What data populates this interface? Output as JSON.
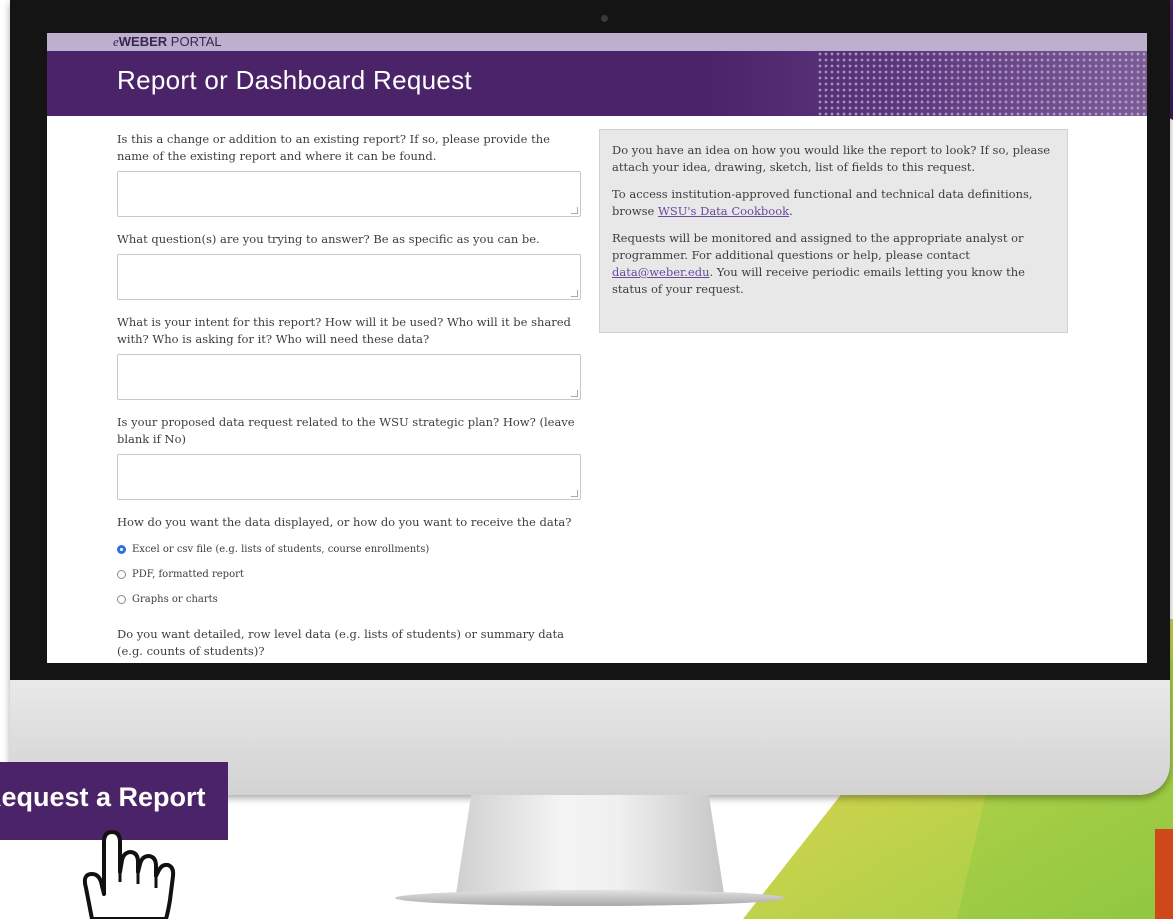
{
  "portal": {
    "brand_e": "e",
    "brand_weber": "WEBER",
    "brand_portal": " PORTAL",
    "page_title": "Report or Dashboard Request"
  },
  "form": {
    "questions": [
      {
        "label": "Is this a change or addition to an existing report? If so, please provide the name of the existing report and where it can be found."
      },
      {
        "label": "What question(s) are you trying to answer? Be as specific as you can be."
      },
      {
        "label": "What is your intent for this report? How will it be used? Who will it be shared with? Who is asking for it? Who will need these data?"
      },
      {
        "label": "Is your proposed data request related to the WSU strategic plan? How? (leave blank if No)"
      }
    ],
    "display_question": "How do you want the data displayed, or how do you want to receive the data?",
    "display_options": [
      {
        "label": "Excel or csv file (e.g. lists of students, course enrollments)",
        "selected": true
      },
      {
        "label": "PDF, formatted report",
        "selected": false
      },
      {
        "label": "Graphs or charts",
        "selected": false
      }
    ],
    "detail_question": "Do you want detailed, row level data (e.g. lists of students) or summary data (e.g. counts of students)?"
  },
  "info": {
    "p1": "Do you have an idea on how you would like the report to look? If so, please attach your idea, drawing, sketch, list of fields to this request.",
    "p2_before": "To access institution-approved functional and technical data definitions, browse ",
    "p2_link": "WSU's Data Cookbook",
    "p2_after": ".",
    "p3_before": "Requests will be monitored and assigned to the appropriate analyst or programmer. For additional questions or help, please contact ",
    "p3_link": "data@weber.edu",
    "p3_after": ". You will receive periodic emails letting you know the status of your request."
  },
  "request_button": {
    "label": "Request a Report"
  },
  "colors": {
    "brand_purple": "#4b2369",
    "radio_selected": "#2f6fe0",
    "link": "#6a4a9c"
  },
  "icons": {
    "pointer": "hand-pointer-icon"
  }
}
